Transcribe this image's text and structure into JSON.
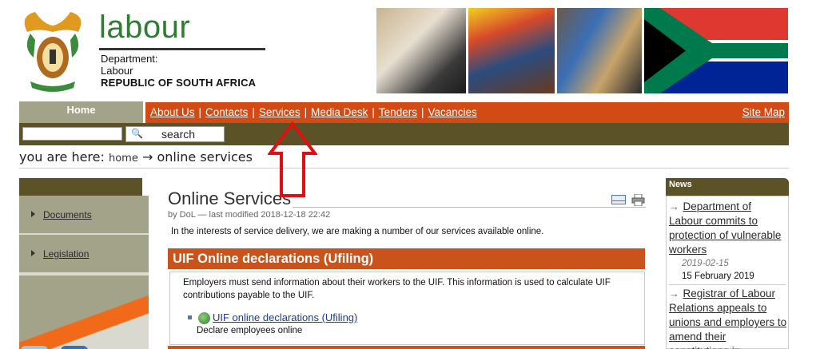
{
  "header": {
    "brand": "labour",
    "dept_line1": "Department:",
    "dept_line2": "Labour",
    "dept_line3": "REPUBLIC OF SOUTH AFRICA"
  },
  "nav": {
    "home": "Home",
    "links": [
      "About Us",
      "Contacts",
      "Services",
      "Media Desk",
      "Tenders",
      "Vacancies"
    ],
    "separator": "|",
    "site_map": "Site Map"
  },
  "search": {
    "input_value": "",
    "button_label": "search"
  },
  "breadcrumb": {
    "prefix": "you are here:",
    "home": "home",
    "arrow": "→",
    "current": "online services"
  },
  "left_nav": {
    "items": [
      "Documents",
      "Legislation"
    ]
  },
  "main": {
    "title": "Online Services",
    "byline": "by DoL — last modified 2018-12-18 22:42",
    "intro": "In the interests of service delivery, we are making a number of our services available online.",
    "section_title": "UIF Online declarations (Ufiling)",
    "section_text": "Employers must send information about their workers to the UIF. This information is used to calculate UIF contributions payable to the UIF.",
    "link_label": "UIF online declarations (Ufiling)",
    "link_desc": "Declare employees online"
  },
  "news": {
    "heading": "News",
    "items": [
      {
        "title": "Department of Labour commits to protection of vulnerable workers",
        "date1": "2019-02-15",
        "date2": "15 February 2019"
      },
      {
        "title": "Registrar of Labour Relations appeals to unions and employers to amend their constitutions in",
        "date1": "",
        "date2": ""
      }
    ]
  },
  "colors": {
    "nav_orange": "#d24a14",
    "olive_dark": "#5c5228",
    "olive_light": "#a3a38a",
    "brand_green": "#2f7d32",
    "annotation_red": "#e01010"
  }
}
